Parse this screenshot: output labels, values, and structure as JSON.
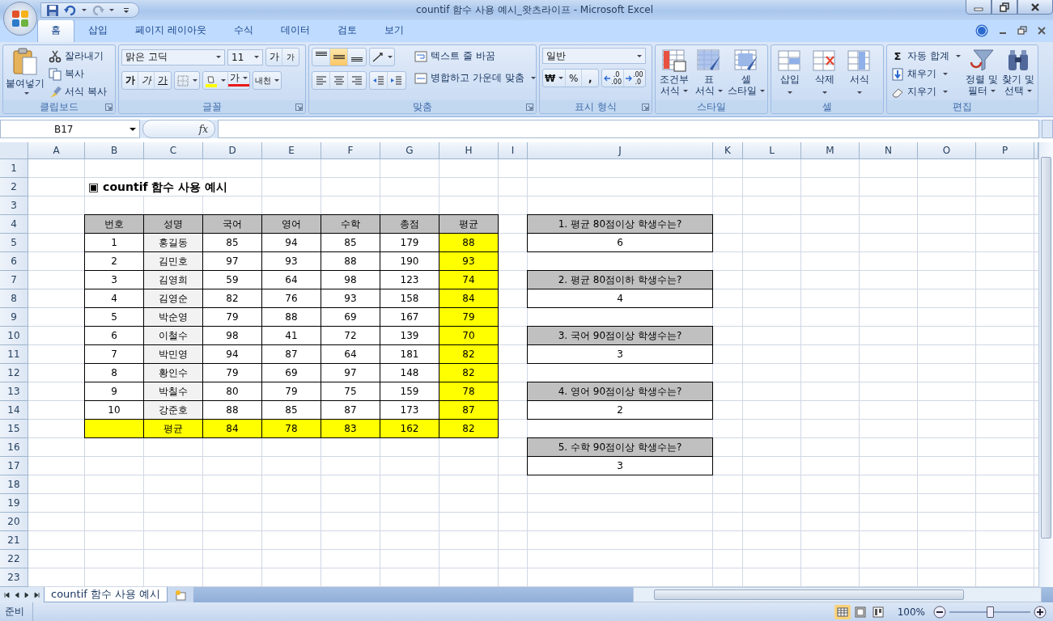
{
  "window": {
    "title": "countif 함수 사용 예시_왓츠라이프 - Microsoft Excel"
  },
  "ribbon_tabs": [
    {
      "label": "홈",
      "selected": true
    },
    {
      "label": "삽입",
      "selected": false
    },
    {
      "label": "페이지 레이아웃",
      "selected": false
    },
    {
      "label": "수식",
      "selected": false
    },
    {
      "label": "데이터",
      "selected": false
    },
    {
      "label": "검토",
      "selected": false
    },
    {
      "label": "보기",
      "selected": false
    }
  ],
  "ribbon_groups": [
    {
      "kind": "clipboard",
      "label": "클립보드",
      "paste": "붙여넣기",
      "small": [
        "잘라내기",
        "복사",
        "서식 복사"
      ]
    },
    {
      "kind": "font",
      "label": "글꼴",
      "font_name": "맑은 고딕",
      "font_size": "11",
      "grow": "가",
      "shrink": "가",
      "bold": "가",
      "italic": "가",
      "underline": "가",
      "font_color": "가",
      "phonetic": "내천"
    },
    {
      "kind": "alignment",
      "label": "맞춤",
      "vertical_align": [
        {
          "selected": false
        },
        {
          "selected": true
        },
        {
          "selected": false
        }
      ],
      "wrap": "텍스트 줄 바꿈",
      "merge": "병합하고 가운데 맞춤"
    },
    {
      "kind": "number",
      "label": "표시 형식",
      "format": "일반",
      "currency": "₩",
      "percent": "%",
      "comma": ",",
      "increase_decimal": [
        ".0",
        ".00"
      ],
      "decrease_decimal": [
        ".00",
        ".0"
      ]
    },
    {
      "kind": "large",
      "label": "스타일",
      "buttons": [
        {
          "lines": [
            "조건부",
            "서식"
          ]
        },
        {
          "lines": [
            "표",
            "서식"
          ]
        },
        {
          "lines": [
            "셀",
            "스타일"
          ]
        }
      ]
    },
    {
      "kind": "large",
      "label": "셀",
      "buttons": [
        {
          "lines": [
            "삽입"
          ]
        },
        {
          "lines": [
            "삭제"
          ]
        },
        {
          "lines": [
            "서식"
          ]
        }
      ]
    },
    {
      "kind": "editing",
      "label": "편집",
      "sum_symbol": "Σ",
      "small": [
        "자동 합계",
        "채우기",
        "지우기"
      ],
      "buttons": [
        {
          "lines": [
            "정렬 및",
            "필터"
          ]
        },
        {
          "lines": [
            "찾기 및",
            "선택"
          ]
        }
      ]
    }
  ],
  "formula_bar": {
    "name_box": "B17",
    "function_label": "fx"
  },
  "sheet": {
    "columns": [
      "A",
      "B",
      "C",
      "D",
      "E",
      "F",
      "G",
      "H",
      "I",
      "J",
      "K",
      "L",
      "M",
      "N",
      "O",
      "P"
    ],
    "row_numbers": [
      "1",
      "2",
      "3",
      "4",
      "5",
      "6",
      "7",
      "8",
      "9",
      "10",
      "11",
      "12",
      "13",
      "14",
      "15",
      "16",
      "17",
      "18",
      "19",
      "20",
      "21",
      "22",
      "23"
    ],
    "title": "▣ countif 함수 사용 예시",
    "table": {
      "header": [
        "번호",
        "성명",
        "국어",
        "영어",
        "수학",
        "총점",
        "평균"
      ],
      "rows": [
        [
          "1",
          "홍길동",
          "85",
          "94",
          "85",
          "179",
          "88"
        ],
        [
          "2",
          "김민호",
          "97",
          "93",
          "88",
          "190",
          "93"
        ],
        [
          "3",
          "김영희",
          "59",
          "64",
          "98",
          "123",
          "74"
        ],
        [
          "4",
          "김영순",
          "82",
          "76",
          "93",
          "158",
          "84"
        ],
        [
          "5",
          "박순영",
          "79",
          "88",
          "69",
          "167",
          "79"
        ],
        [
          "6",
          "이철수",
          "98",
          "41",
          "72",
          "139",
          "70"
        ],
        [
          "7",
          "박민영",
          "94",
          "87",
          "64",
          "181",
          "82"
        ],
        [
          "8",
          "황인수",
          "79",
          "69",
          "97",
          "148",
          "82"
        ],
        [
          "9",
          "박칠수",
          "80",
          "79",
          "75",
          "159",
          "78"
        ],
        [
          "10",
          "강준호",
          "88",
          "85",
          "87",
          "173",
          "87"
        ]
      ],
      "footer": {
        "label": "평균",
        "values": [
          "84",
          "78",
          "83",
          "162",
          "82"
        ]
      }
    },
    "questions": [
      {
        "question": "1. 평균 80점이상 학생수는?",
        "answer": "6"
      },
      {
        "question": "2. 평균 80점이하 학생수는?",
        "answer": "4"
      },
      {
        "question": "3. 국어 90점이상 학생수는?",
        "answer": "3"
      },
      {
        "question": "4. 영어 90점이상 학생수는?",
        "answer": "2"
      },
      {
        "question": "5. 수학 90점이상 학생수는?",
        "answer": "3"
      }
    ]
  },
  "sheet_tabs": [
    {
      "label": "countif 함수 사용 예시",
      "selected": true
    }
  ],
  "status_bar": {
    "status": "준비",
    "zoom": "100%",
    "zoom_slider": {
      "level": 0.5
    }
  }
}
